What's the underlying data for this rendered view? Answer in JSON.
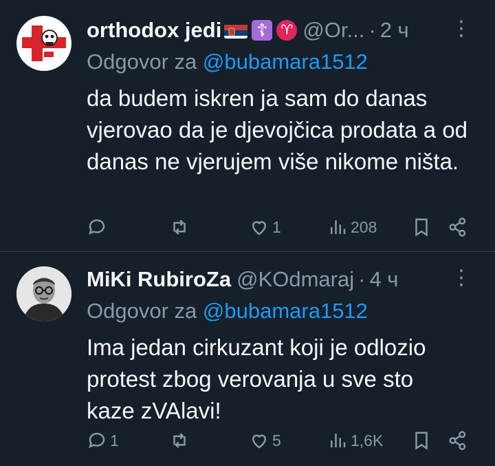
{
  "tweets": [
    {
      "name": "orthodox jedi",
      "handle": "@Or...",
      "dot": "·",
      "time": "2 ч",
      "reply_prefix": "Odgovor za",
      "reply_to": "@bubamara1512",
      "text": "da budem iskren ja sam do danas vjerovao da je djevojčica prodata a od danas ne vjerujem više nikome ništa.",
      "counts": {
        "replies": "",
        "retweets": "",
        "likes": "1",
        "views": "208"
      },
      "badges": [
        "serbia-flag-icon",
        "orthodox-cross-icon",
        "aries-icon"
      ]
    },
    {
      "name": "MiKi RubiroZa",
      "handle": "@KOdmaraj",
      "dot": "·",
      "time": "4 ч",
      "reply_prefix": "Odgovor za",
      "reply_to": "@bubamara1512",
      "text": "Ima jedan cirkuzant koji je odlozio protest zbog verovanja u sve sto kaze zVAlavi!",
      "counts": {
        "replies": "1",
        "retweets": "",
        "likes": "5",
        "views": "1,6K"
      }
    }
  ],
  "colors": {
    "background": "#15202b",
    "muted": "#8b98a5",
    "accent": "#1d9bf0",
    "divider": "#38444d"
  }
}
